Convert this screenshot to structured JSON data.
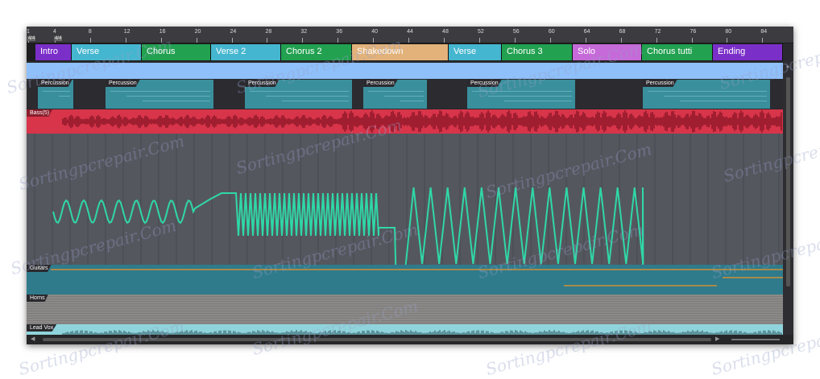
{
  "ruler": {
    "bars": [
      "1",
      "4",
      "8",
      "12",
      "16",
      "20",
      "24",
      "28",
      "32",
      "36",
      "40",
      "44",
      "48",
      "52",
      "56",
      "60",
      "64",
      "68",
      "72",
      "76",
      "80",
      "84"
    ],
    "time_signature": "4/4"
  },
  "markers": [
    {
      "label": "Intro",
      "color": "#7b2fc9"
    },
    {
      "label": "Verse",
      "color": "#45b6cf"
    },
    {
      "label": "Chorus",
      "color": "#22a150"
    },
    {
      "label": "Verse 2",
      "color": "#45b6cf"
    },
    {
      "label": "Chorus 2",
      "color": "#22a150"
    },
    {
      "label": "Shakedown",
      "color": "#e2b27a"
    },
    {
      "label": "Verse",
      "color": "#45b6cf"
    },
    {
      "label": "Chorus 3",
      "color": "#22a150"
    },
    {
      "label": "Solo",
      "color": "#c56ad8"
    },
    {
      "label": "Chorus tutti",
      "color": "#22a150"
    },
    {
      "label": "Ending",
      "color": "#7b2fc9"
    }
  ],
  "tracks": {
    "percussion": "Percussion",
    "bass": "Bass(5)",
    "guitars": "Guitars",
    "horns": "Horns",
    "lead_vox": "Lead Vox"
  },
  "watermark": "Sortingpcrepair.Com"
}
